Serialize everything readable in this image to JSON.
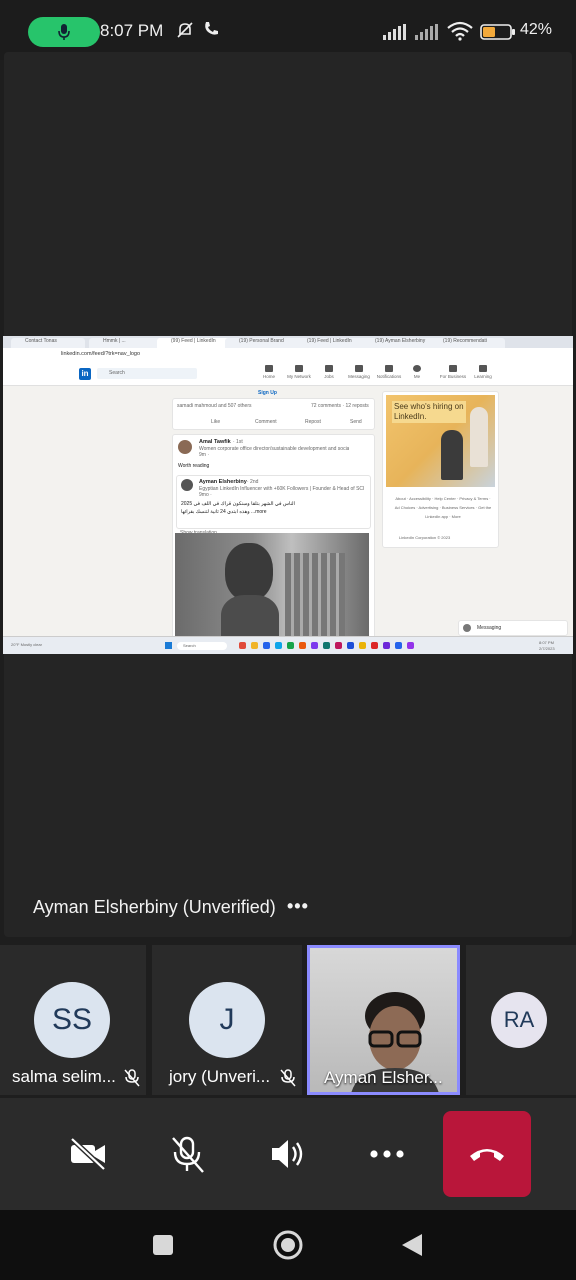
{
  "status_bar": {
    "time": "8:07 PM",
    "battery": "42%",
    "icons": [
      "microphone-icon",
      "mute-notifications-icon",
      "phone-icon",
      "signal-icon",
      "wifi-icon",
      "battery-icon"
    ]
  },
  "shared_screen": {
    "tabs": [
      "Contact Tonas",
      "Hmmk | ...",
      "(99) Feed | LinkedIn",
      "(19) Personal Brand",
      "(19) Feed | LinkedIn",
      "(19) Ayman Elsherbiny",
      "(19) Recommendati"
    ],
    "url": "linkedin.com/feed/?trk=nav_logo",
    "search_placeholder": "Search",
    "nav": [
      "Home",
      "My Network",
      "Jobs",
      "Messaging",
      "Notifications",
      "Me",
      "For Business",
      "Learning"
    ],
    "feed": {
      "sign_up": "Sign Up",
      "reactions": "samadi mahmoud and 507 others",
      "comments": "72 comments · 12 reposts",
      "actions": [
        "Like",
        "Comment",
        "Repost",
        "Send"
      ],
      "post_author": "Amal Tawfik",
      "post_degree": "· 1st",
      "post_headline": "Women corporate office director/sustainable development and social le...",
      "post_time": "9m ·",
      "post_text": "Worth reading",
      "shared_author": "Ayman Elsherbiny",
      "shared_degree": "· 2nd",
      "shared_headline": "Egyptian LinkedIn Influencer with +60K Followers | Founder & Head of SCI | Lo...",
      "shared_time": "9mo ·",
      "shared_text_1": "الناس في الشهر بتلقا وسنكون قراك في اللف في 2025",
      "shared_text_2": "وهذه ابتدي 24 ثانية لتنسك بقرائها ...more",
      "show_translation": "Show translation"
    },
    "ad": {
      "headline": "See who's hiring on LinkedIn.",
      "footer": "About · Accessibility · Help Center · Privacy & Terms · Ad Choices · Advertising · Business Services · Get the LinkedIn app · More",
      "copyright": "LinkedIn Corporation © 2023"
    },
    "messaging": "Messaging",
    "taskbar_search": "Search",
    "taskbar_time": "8:07 PM",
    "taskbar_date": "2/7/2023",
    "weather": "20°F Mostly clear"
  },
  "speaker": {
    "name": "Ayman Elsherbiny (Unverified)",
    "more": "•••"
  },
  "participants": [
    {
      "initials": "SS",
      "name": "salma selim...",
      "muted": true
    },
    {
      "initials": "J",
      "name": "jory (Unveri...",
      "muted": true
    },
    {
      "initials": "",
      "name": "Ayman Elsher...",
      "muted": false
    },
    {
      "initials": "RA",
      "name": "",
      "muted": false
    }
  ],
  "controls": [
    "camera-off-icon",
    "mic-off-icon",
    "speaker-icon",
    "more-icon",
    "hang-up-icon"
  ],
  "colors": {
    "background": "#1e1e1e",
    "hangup": "#b9163a",
    "active_border": "#8b8bff",
    "mic_pill": "#27c46b",
    "linkedin_blue": "#0a66c2"
  }
}
